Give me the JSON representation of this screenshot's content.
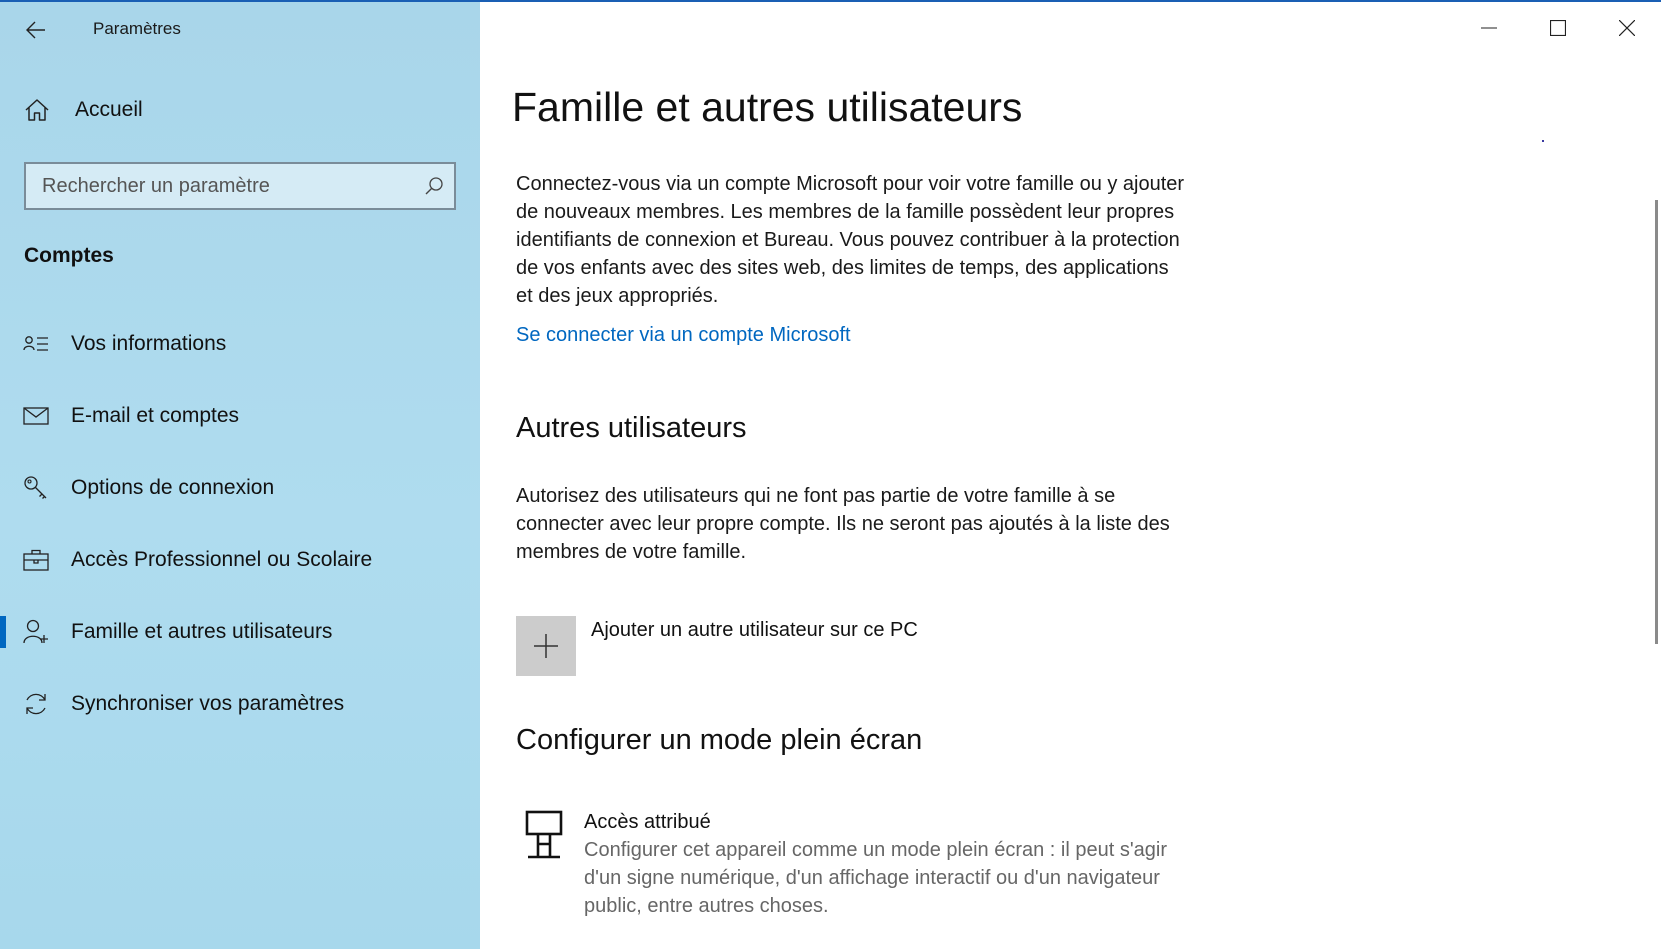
{
  "app": {
    "title": "Paramètres"
  },
  "sidebar": {
    "home_label": "Accueil",
    "search_placeholder": "Rechercher un paramètre",
    "section_label": "Comptes",
    "items": [
      {
        "label": "Vos informations",
        "icon": "person-card-icon",
        "selected": false
      },
      {
        "label": "E-mail et comptes",
        "icon": "mail-icon",
        "selected": false
      },
      {
        "label": "Options de connexion",
        "icon": "key-icon",
        "selected": false
      },
      {
        "label": "Accès Professionnel ou Scolaire",
        "icon": "briefcase-icon",
        "selected": false
      },
      {
        "label": "Famille et autres utilisateurs",
        "icon": "person-add-icon",
        "selected": true
      },
      {
        "label": "Synchroniser vos paramètres",
        "icon": "sync-icon",
        "selected": false
      }
    ]
  },
  "main": {
    "page_title": "Famille et autres utilisateurs",
    "family_description": "Connectez-vous via un compte Microsoft pour voir votre famille ou y ajouter de nouveaux membres. Les membres de la famille possèdent leur propres identifiants de connexion et Bureau. Vous pouvez contribuer à la protection de vos enfants avec des sites web, des limites de temps, des applications et des jeux appropriés.",
    "signin_link": "Se connecter via un compte Microsoft",
    "other_users_heading": "Autres utilisateurs",
    "other_users_description": "Autorisez des utilisateurs qui ne font pas partie de votre famille à se connecter avec leur propre compte. Ils ne seront pas ajoutés à la liste des membres de votre famille.",
    "add_user_label": "Ajouter un autre utilisateur sur ce PC",
    "kiosk_heading": "Configurer un mode plein écran",
    "assigned_access_title": "Accès attribué",
    "assigned_access_description": "Configurer cet appareil comme un mode plein écran : il peut s'agir d'un signe numérique, d'un affichage interactif ou d'un navigateur public, entre autres choses."
  },
  "colors": {
    "sidebar_bg": "#afdcef",
    "accent": "#0067c0",
    "add_tile": "#cccccc"
  }
}
